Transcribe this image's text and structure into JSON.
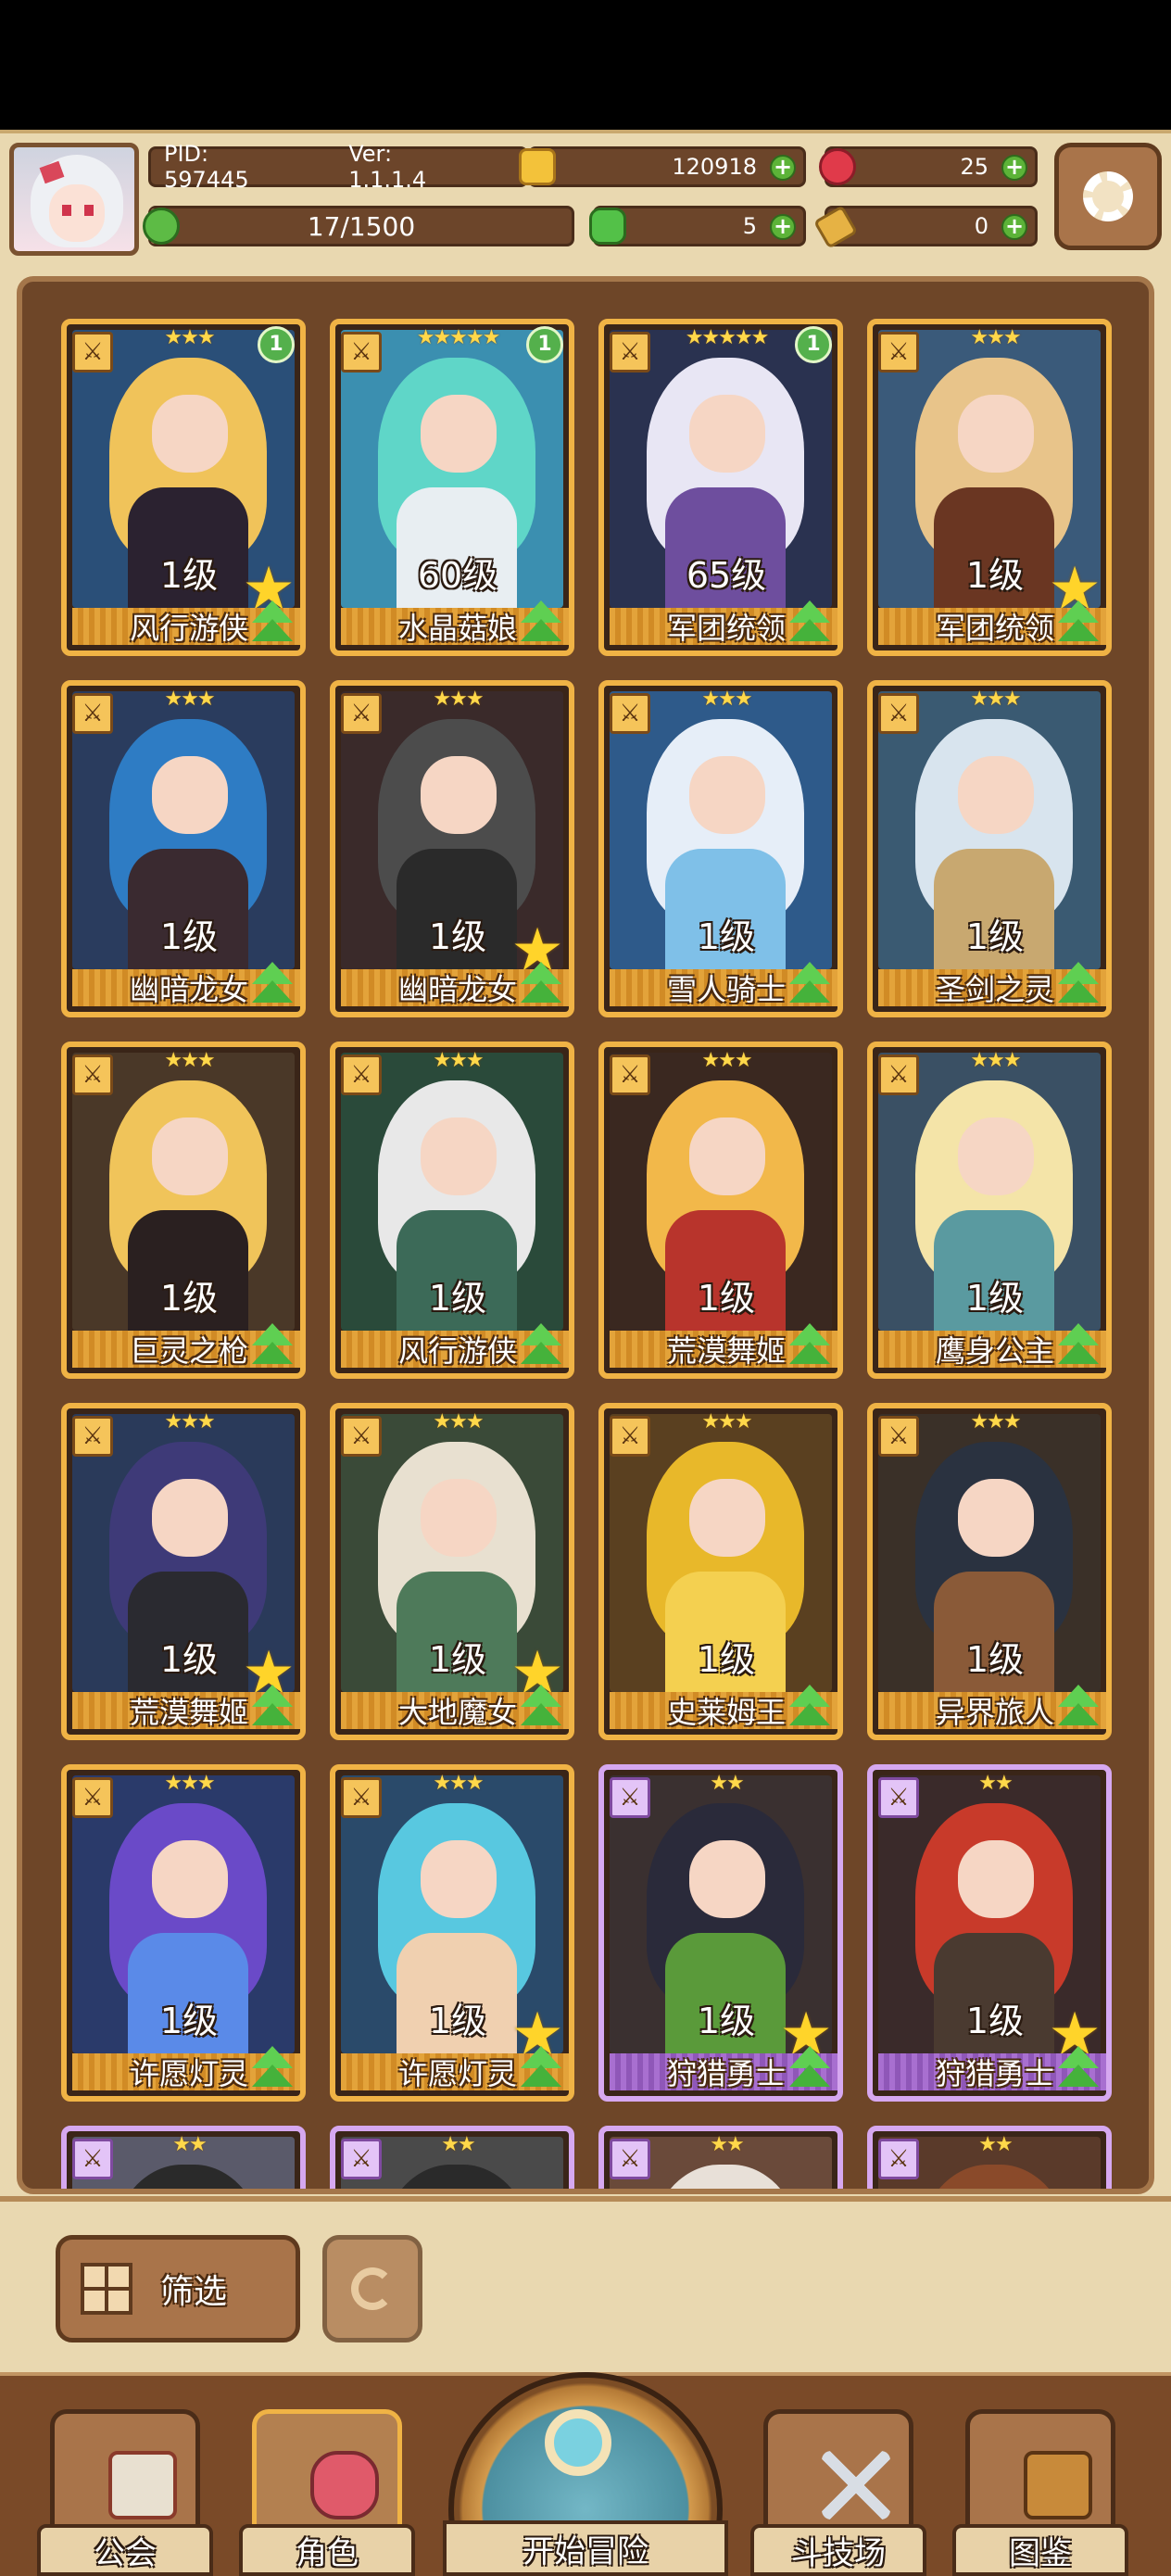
{
  "header": {
    "pid_label": "PID: 597445",
    "version_label": "Ver: 1.1.1.4",
    "gold": "120918",
    "gems": "25",
    "stamina": "17/1500",
    "stamina_fraction": 0.011,
    "clover": "5",
    "keys": "0"
  },
  "icons": {
    "settings": "gear-icon",
    "gold": "gold-coin-icon",
    "gems": "red-gem-icon",
    "stamina": "green-energy-icon",
    "clover": "clover-icon",
    "keys": "key-icon",
    "filter": "grid-icon",
    "refresh": "refresh-icon"
  },
  "colors": {
    "rarity_gold": "#f0b345",
    "rarity_purple": "#d6a8f0",
    "plus_green": "#5cb338",
    "panel_brown": "#6e4628"
  },
  "characters": [
    {
      "name": "风行游侠",
      "level": "1级",
      "stars": "★★★",
      "copies": "1",
      "favorite": true,
      "rarity": "gold",
      "palette": [
        "#2a4f78",
        "#f0c35a",
        "#2b2230"
      ]
    },
    {
      "name": "水晶菇娘",
      "level": "60级",
      "stars": "★★★★★",
      "copies": "1",
      "favorite": false,
      "rarity": "gold",
      "palette": [
        "#3b8fb0",
        "#5fd6c8",
        "#e8eef2"
      ]
    },
    {
      "name": "军团统领",
      "level": "65级",
      "stars": "★★★★★",
      "copies": "1",
      "favorite": false,
      "rarity": "gold",
      "palette": [
        "#2a3250",
        "#e8e6f4",
        "#6e4e9e"
      ]
    },
    {
      "name": "军团统领",
      "level": "1级",
      "stars": "★★★",
      "copies": "",
      "favorite": true,
      "rarity": "gold",
      "palette": [
        "#3a5a7a",
        "#e8c48a",
        "#6a3622"
      ]
    },
    {
      "name": "幽暗龙女",
      "level": "1级",
      "stars": "★★★",
      "copies": "",
      "favorite": false,
      "rarity": "gold",
      "palette": [
        "#2a3c5e",
        "#2e7cc4",
        "#3a2a30"
      ]
    },
    {
      "name": "幽暗龙女",
      "level": "1级",
      "stars": "★★★",
      "copies": "",
      "favorite": true,
      "rarity": "gold",
      "palette": [
        "#3a2a2a",
        "#4c4c4c",
        "#2a2a2a"
      ]
    },
    {
      "name": "雪人骑士",
      "level": "1级",
      "stars": "★★★",
      "copies": "",
      "favorite": false,
      "rarity": "gold",
      "palette": [
        "#2e5a8a",
        "#e6eef8",
        "#7fc0e8"
      ]
    },
    {
      "name": "圣剑之灵",
      "level": "1级",
      "stars": "★★★",
      "copies": "",
      "favorite": false,
      "rarity": "gold",
      "palette": [
        "#3a5a72",
        "#d8e4ee",
        "#c8a870"
      ]
    },
    {
      "name": "巨灵之枪",
      "level": "1级",
      "stars": "★★★",
      "copies": "",
      "favorite": false,
      "rarity": "gold",
      "palette": [
        "#4a3828",
        "#f0c45a",
        "#2a2020"
      ]
    },
    {
      "name": "风行游侠",
      "level": "1级",
      "stars": "★★★",
      "copies": "",
      "favorite": false,
      "rarity": "gold",
      "palette": [
        "#2a4a3a",
        "#e8e8e8",
        "#3c6a58"
      ]
    },
    {
      "name": "荒漠舞姬",
      "level": "1级",
      "stars": "★★★",
      "copies": "",
      "favorite": false,
      "rarity": "gold",
      "palette": [
        "#3a2820",
        "#f2b84a",
        "#b8342c"
      ]
    },
    {
      "name": "鹰身公主",
      "level": "1级",
      "stars": "★★★",
      "copies": "",
      "favorite": false,
      "rarity": "gold",
      "palette": [
        "#3a5064",
        "#f4e4a8",
        "#5a9aa0"
      ]
    },
    {
      "name": "荒漠舞姬",
      "level": "1级",
      "stars": "★★★",
      "copies": "",
      "favorite": true,
      "rarity": "gold",
      "palette": [
        "#2a3a5a",
        "#3e3a78",
        "#2a2a30"
      ]
    },
    {
      "name": "大地魔女",
      "level": "1级",
      "stars": "★★★",
      "copies": "",
      "favorite": true,
      "rarity": "gold",
      "palette": [
        "#3a4a38",
        "#e8e0d0",
        "#4e7a5a"
      ]
    },
    {
      "name": "史莱姆王",
      "level": "1级",
      "stars": "★★★",
      "copies": "",
      "favorite": false,
      "rarity": "gold",
      "palette": [
        "#5a4020",
        "#e8b82a",
        "#f4d050"
      ]
    },
    {
      "name": "异界旅人",
      "level": "1级",
      "stars": "★★★",
      "copies": "",
      "favorite": false,
      "rarity": "gold",
      "palette": [
        "#3a3028",
        "#2a3240",
        "#8a5a38"
      ]
    },
    {
      "name": "许愿灯灵",
      "level": "1级",
      "stars": "★★★",
      "copies": "",
      "favorite": false,
      "rarity": "gold",
      "palette": [
        "#2a3a6a",
        "#6a4ac8",
        "#5a8ae8"
      ]
    },
    {
      "name": "许愿灯灵",
      "level": "1级",
      "stars": "★★★",
      "copies": "",
      "favorite": true,
      "rarity": "gold",
      "palette": [
        "#2a4a6a",
        "#58c8e0",
        "#f0d0b0"
      ]
    },
    {
      "name": "狩猎勇士",
      "level": "1级",
      "stars": "★★",
      "copies": "",
      "favorite": true,
      "rarity": "purple",
      "palette": [
        "#3a3030",
        "#2a2a3a",
        "#5a9a3a"
      ]
    },
    {
      "name": "狩猎勇士",
      "level": "1级",
      "stars": "★★",
      "copies": "",
      "favorite": true,
      "rarity": "purple",
      "palette": [
        "#3a2a2a",
        "#c83a2a",
        "#4a3a30"
      ]
    },
    {
      "name": "",
      "level": "",
      "stars": "★★",
      "copies": "",
      "favorite": false,
      "rarity": "purple",
      "palette": [
        "#5a5a6a",
        "#2a2a2a",
        "#d0b0a0"
      ]
    },
    {
      "name": "",
      "level": "",
      "stars": "★★",
      "copies": "",
      "favorite": false,
      "rarity": "purple",
      "palette": [
        "#4a4a4a",
        "#2a2a2a",
        "#7a7a7a"
      ]
    },
    {
      "name": "",
      "level": "",
      "stars": "★★",
      "copies": "",
      "favorite": false,
      "rarity": "purple",
      "palette": [
        "#6a4a3a",
        "#e8e0d8",
        "#8a3a2a"
      ]
    },
    {
      "name": "",
      "level": "",
      "stars": "★★",
      "copies": "",
      "favorite": false,
      "rarity": "purple",
      "palette": [
        "#5a3a2a",
        "#8a4a2a",
        "#3a2a2a"
      ]
    }
  ],
  "toolbar": {
    "filter_label": "筛选"
  },
  "nav": {
    "guild": "公会",
    "characters": "角色",
    "adventure": "开始冒险",
    "arena": "斗技场",
    "codex": "图鉴"
  }
}
